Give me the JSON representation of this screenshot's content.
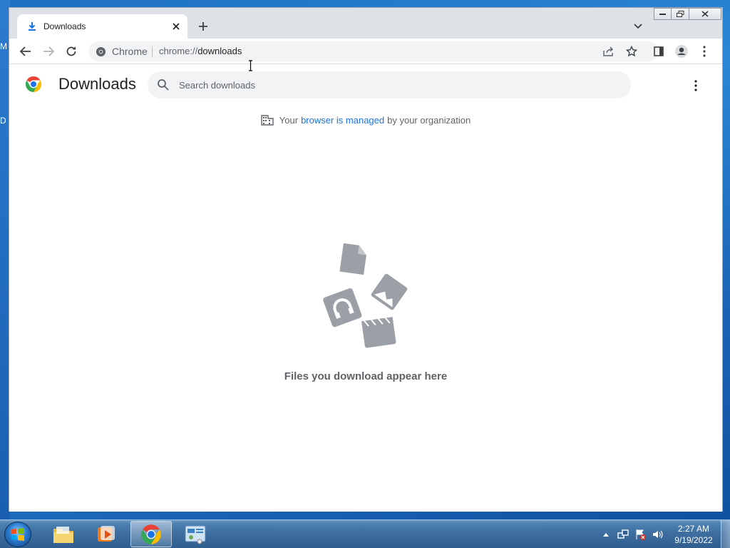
{
  "desktop": {
    "label_top": "M",
    "label_mid": "D"
  },
  "window": {
    "controls": [
      "minimize-icon",
      "restore-icon",
      "close-icon"
    ]
  },
  "tab": {
    "title": "Downloads",
    "icon": "download-icon"
  },
  "toolbar": {
    "site_label": "Chrome",
    "url_scheme": "chrome://",
    "url_path": "downloads"
  },
  "page": {
    "title": "Downloads",
    "search_placeholder": "Search downloads",
    "managed_prefix": "Your",
    "managed_link": "browser is managed",
    "managed_suffix": "by your organization",
    "empty_message": "Files you download appear here"
  },
  "taskbar": {
    "apps": [
      "file-explorer-icon",
      "media-player-icon",
      "chrome-icon",
      "control-panel-icon"
    ],
    "active_app": "chrome-icon",
    "time": "2:27 AM",
    "date": "9/19/2022"
  },
  "colors": {
    "accent": "#1a73e8",
    "illustration": "#9aa0a6"
  }
}
